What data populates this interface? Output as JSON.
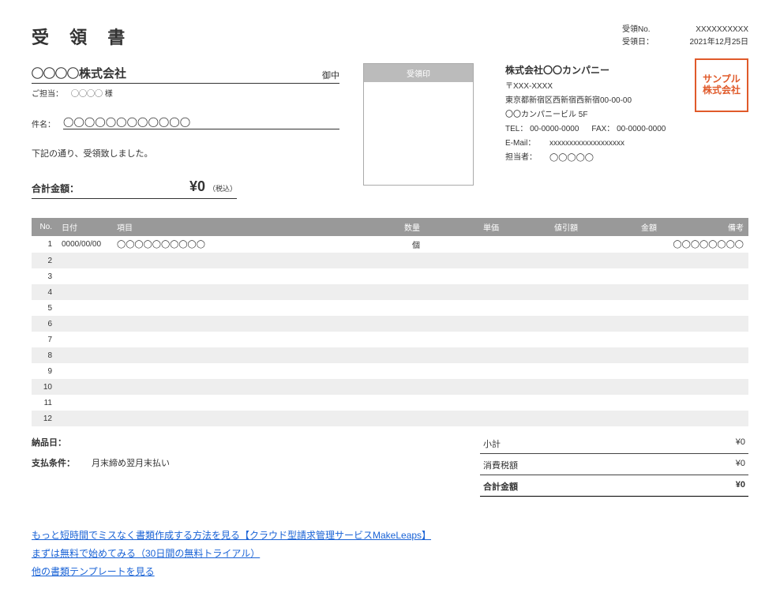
{
  "doc_title": "受 領 書",
  "meta": {
    "no_label": "受領No.",
    "no_value": "XXXXXXXXXX",
    "date_label": "受領日：",
    "date_value": "2021年12月25日"
  },
  "client": {
    "name": "◯◯◯◯株式会社",
    "onchu": "御中",
    "contact_label": "ご担当：",
    "contact_value": "◯◯◯◯ 様",
    "subject_label": "件名：",
    "subject_value": "◯◯◯◯◯◯◯◯◯◯◯◯",
    "note": "下記の通り、受領致しました。",
    "total_label": "合計金額：",
    "total_value": "¥0",
    "tax_note": "（税込）"
  },
  "stamp_header": "受領印",
  "company": {
    "name": "株式会社〇〇カンパニー",
    "postal": "〒XXX-XXXX",
    "address1": "東京都新宿区西新宿西新宿00-00-00",
    "address2": "〇〇カンパニービル 5F",
    "tel_label": "TEL：",
    "tel": "00-0000-0000",
    "fax_label": "FAX：",
    "fax": "00-0000-0000",
    "email_label": "E-Mail：",
    "email": "xxxxxxxxxxxxxxxxxxx",
    "person_label": "担当者：",
    "person": "◯◯◯◯◯",
    "seal": "サンプル\n株式会社"
  },
  "table": {
    "headers": {
      "no": "No.",
      "date": "日付",
      "item": "項目",
      "qty": "数量",
      "unitp": "単価",
      "disc": "値引額",
      "amt": "金額",
      "note": "備考"
    },
    "rows": [
      {
        "no": "1",
        "date": "0000/00/00",
        "item": "◯◯◯◯◯◯◯◯◯◯",
        "qty": "個",
        "unitp": "",
        "disc": "",
        "amt": "",
        "note": "◯◯◯◯◯◯◯◯"
      },
      {
        "no": "2",
        "date": "",
        "item": "",
        "qty": "",
        "unitp": "",
        "disc": "",
        "amt": "",
        "note": ""
      },
      {
        "no": "3",
        "date": "",
        "item": "",
        "qty": "",
        "unitp": "",
        "disc": "",
        "amt": "",
        "note": ""
      },
      {
        "no": "4",
        "date": "",
        "item": "",
        "qty": "",
        "unitp": "",
        "disc": "",
        "amt": "",
        "note": ""
      },
      {
        "no": "5",
        "date": "",
        "item": "",
        "qty": "",
        "unitp": "",
        "disc": "",
        "amt": "",
        "note": ""
      },
      {
        "no": "6",
        "date": "",
        "item": "",
        "qty": "",
        "unitp": "",
        "disc": "",
        "amt": "",
        "note": ""
      },
      {
        "no": "7",
        "date": "",
        "item": "",
        "qty": "",
        "unitp": "",
        "disc": "",
        "amt": "",
        "note": ""
      },
      {
        "no": "8",
        "date": "",
        "item": "",
        "qty": "",
        "unitp": "",
        "disc": "",
        "amt": "",
        "note": ""
      },
      {
        "no": "9",
        "date": "",
        "item": "",
        "qty": "",
        "unitp": "",
        "disc": "",
        "amt": "",
        "note": ""
      },
      {
        "no": "10",
        "date": "",
        "item": "",
        "qty": "",
        "unitp": "",
        "disc": "",
        "amt": "",
        "note": ""
      },
      {
        "no": "11",
        "date": "",
        "item": "",
        "qty": "",
        "unitp": "",
        "disc": "",
        "amt": "",
        "note": ""
      },
      {
        "no": "12",
        "date": "",
        "item": "",
        "qty": "",
        "unitp": "",
        "disc": "",
        "amt": "",
        "note": ""
      }
    ]
  },
  "bottom": {
    "delivery_label": "納品日：",
    "delivery_value": "",
    "terms_label": "支払条件：",
    "terms_value": "月末締め翌月末払い"
  },
  "totals": {
    "subtotal_label": "小計",
    "subtotal_value": "¥0",
    "tax_label": "消費税額",
    "tax_value": "¥0",
    "grand_label": "合計金額",
    "grand_value": "¥0"
  },
  "links": {
    "l1": "もっと短時間でミスなく書類作成する方法を見る【クラウド型請求管理サービスMakeLeaps】",
    "l2": "まずは無料で始めてみる（30日間の無料トライアル）",
    "l3": "他の書類テンプレートを見る"
  }
}
